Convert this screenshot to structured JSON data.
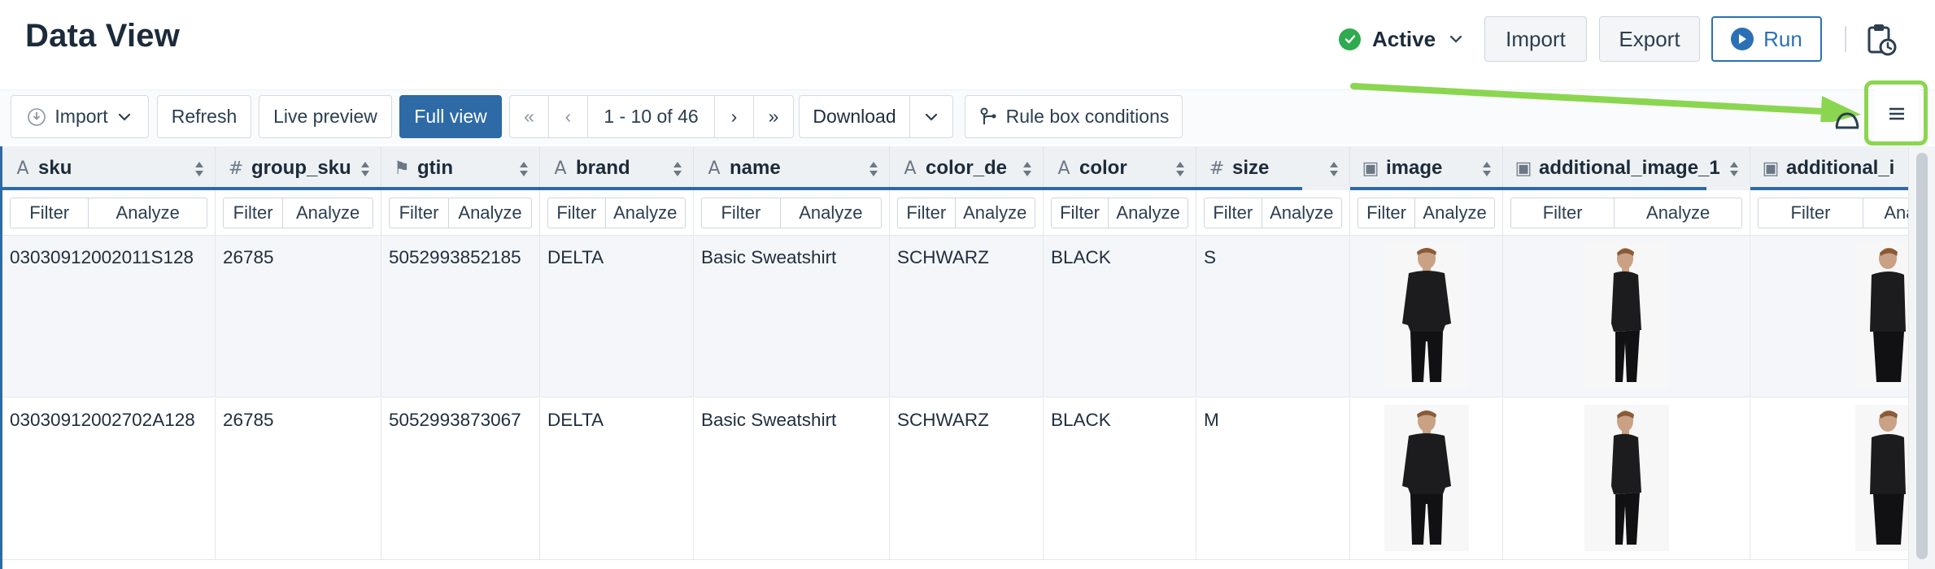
{
  "header": {
    "title": "Data View",
    "status_label": "Active",
    "import_label": "Import",
    "export_label": "Export",
    "run_label": "Run"
  },
  "toolbar": {
    "import_label": "Import",
    "refresh_label": "Refresh",
    "live_preview_label": "Live preview",
    "full_view_label": "Full view",
    "first": "«",
    "prev": "‹",
    "range": "1 - 10 of 46",
    "next": "›",
    "last": "»",
    "download_label": "Download",
    "rule_box_label": "Rule box conditions"
  },
  "columns": [
    {
      "name": "sku",
      "icon": "A"
    },
    {
      "name": "group_sku",
      "icon": "#"
    },
    {
      "name": "gtin",
      "icon": "⚑"
    },
    {
      "name": "brand",
      "icon": "A"
    },
    {
      "name": "name",
      "icon": "A"
    },
    {
      "name": "color_de",
      "icon": "A"
    },
    {
      "name": "color",
      "icon": "A"
    },
    {
      "name": "size",
      "icon": "#"
    },
    {
      "name": "image",
      "icon": "▣"
    },
    {
      "name": "additional_image_1",
      "icon": "▣"
    },
    {
      "name": "additional_i",
      "icon": "▣"
    }
  ],
  "filter_label": "Filter",
  "analyze_label": "Analyze",
  "rows": [
    {
      "sku": "03030912002011S128",
      "group_sku": "26785",
      "gtin": "5052993852185",
      "brand": "DELTA",
      "name": "Basic Sweatshirt",
      "color_de": "SCHWARZ",
      "color": "BLACK",
      "size": "S"
    },
    {
      "sku": "03030912002702A128",
      "group_sku": "26785",
      "gtin": "5052993873067",
      "brand": "DELTA",
      "name": "Basic Sweatshirt",
      "color_de": "SCHWARZ",
      "color": "BLACK",
      "size": "M"
    }
  ],
  "colors": {
    "accent": "#2d6aa6",
    "status_green": "#2eaa4f",
    "highlight_green": "#8bd650"
  }
}
